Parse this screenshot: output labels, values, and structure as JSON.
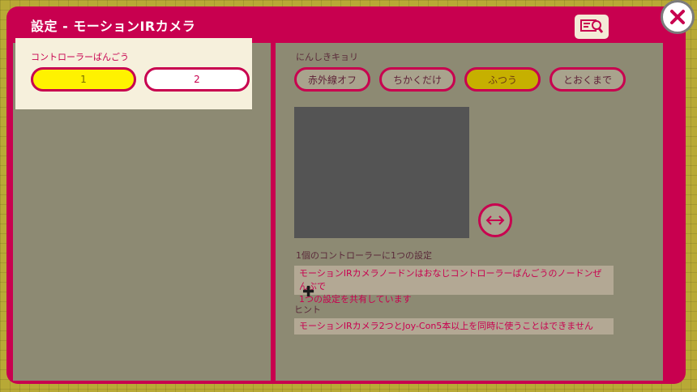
{
  "dialog": {
    "title": "設定 - モーションIRカメラ",
    "search_icon": "search-screen-icon",
    "close_icon": "close-icon"
  },
  "controller": {
    "label": "コントローラーばんごう",
    "options": [
      "1",
      "2"
    ],
    "selected": "1"
  },
  "sensitivity": {
    "label": "にんしきキョリ",
    "options": [
      "赤外線オフ",
      "ちかくだけ",
      "ふつう",
      "とおくまで"
    ],
    "selected": "ふつう"
  },
  "camera": {
    "swap_icon": "swap-horizontal-icon"
  },
  "info": {
    "heading": "1個のコントローラーに1つの設定",
    "body_line1": "モーションIRカメラノードンはおなじコントローラーばんごうのノードンぜんぶで",
    "body_line2": "1つの設定を共有しています"
  },
  "hint": {
    "heading": "ヒント",
    "body": "モーションIRカメラ2つとJoy-Con5本以上を同時に使うことはできません"
  },
  "colors": {
    "accent": "#c8004f",
    "selected": "#fff200",
    "panel": "#8d8a73",
    "camera": "#545454"
  }
}
